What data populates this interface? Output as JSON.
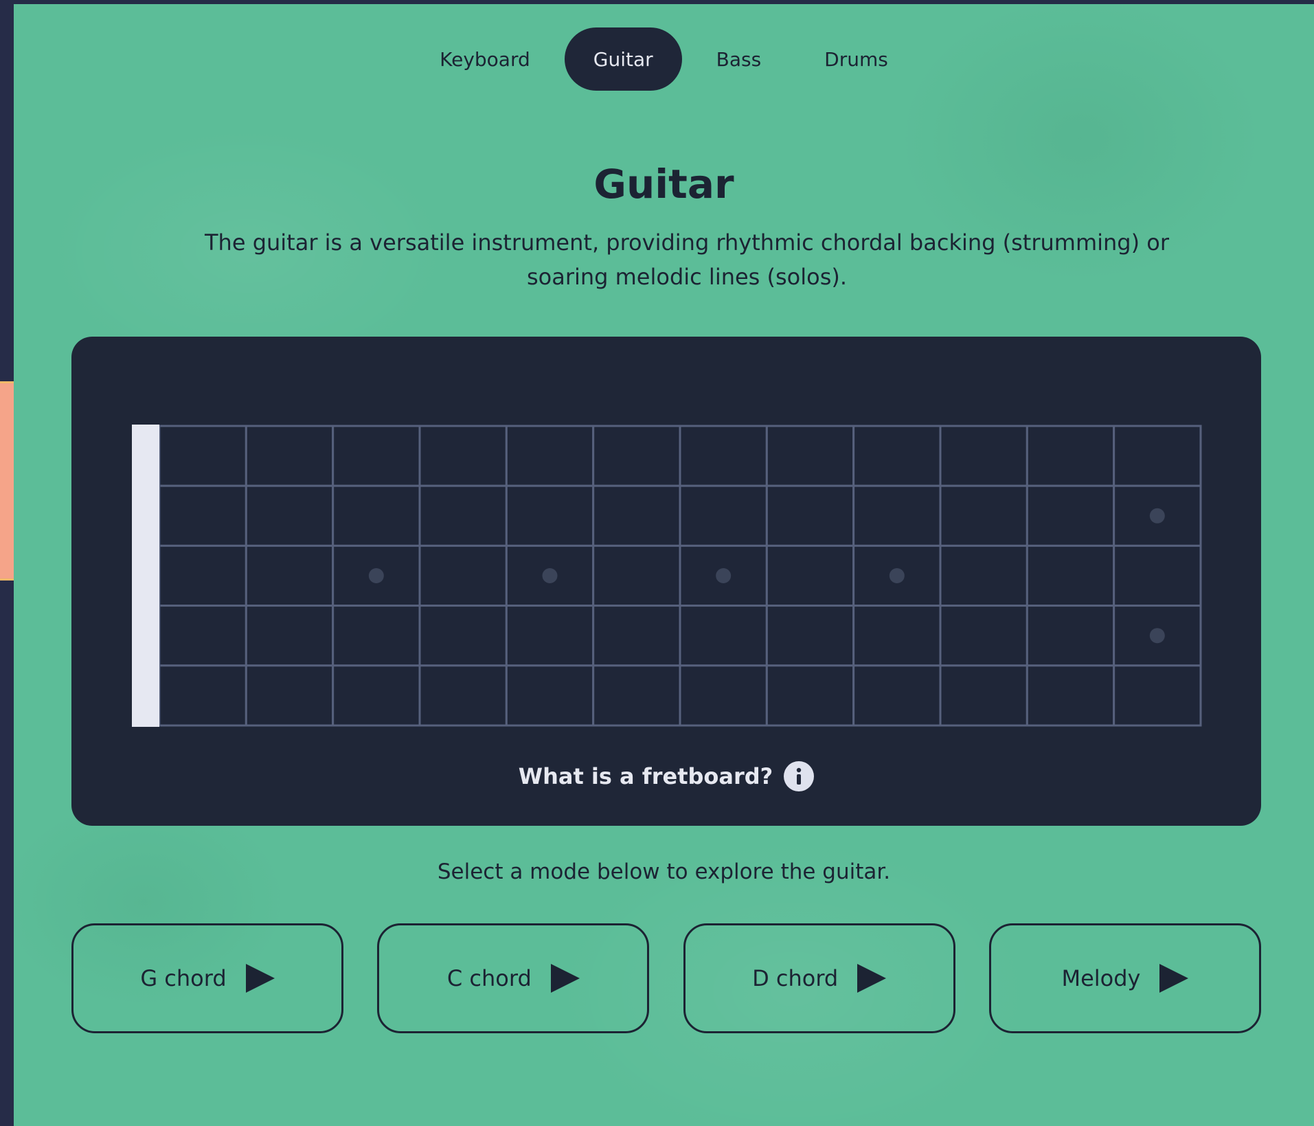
{
  "tabs": [
    {
      "label": "Keyboard",
      "active": false
    },
    {
      "label": "Guitar",
      "active": true
    },
    {
      "label": "Bass",
      "active": false
    },
    {
      "label": "Drums",
      "active": false
    }
  ],
  "section": {
    "title": "Guitar",
    "description": "The guitar is a versatile instrument, providing rhythmic chordal backing (strumming) or soaring melodic lines (solos)."
  },
  "fretboard": {
    "strings": 6,
    "frets": 12,
    "single_marker_frets": [
      3,
      5,
      7,
      9
    ],
    "double_marker_frets": [
      12
    ],
    "help_text": "What is a fretboard?",
    "help_icon": "info-icon"
  },
  "instruction": "Select a mode below to explore the guitar.",
  "modes": [
    {
      "label": "G chord",
      "icon": "play-icon"
    },
    {
      "label": "C chord",
      "icon": "play-icon"
    },
    {
      "label": "D chord",
      "icon": "play-icon"
    },
    {
      "label": "Melody",
      "icon": "play-icon"
    }
  ],
  "colors": {
    "background": "#5cbd98",
    "dark": "#1f2638",
    "fret_line": "#56607c",
    "nut": "#e6e8f2",
    "marker": "#3b4459",
    "sidebar": "#262c48",
    "sidebar_accent": "#f5a489"
  }
}
